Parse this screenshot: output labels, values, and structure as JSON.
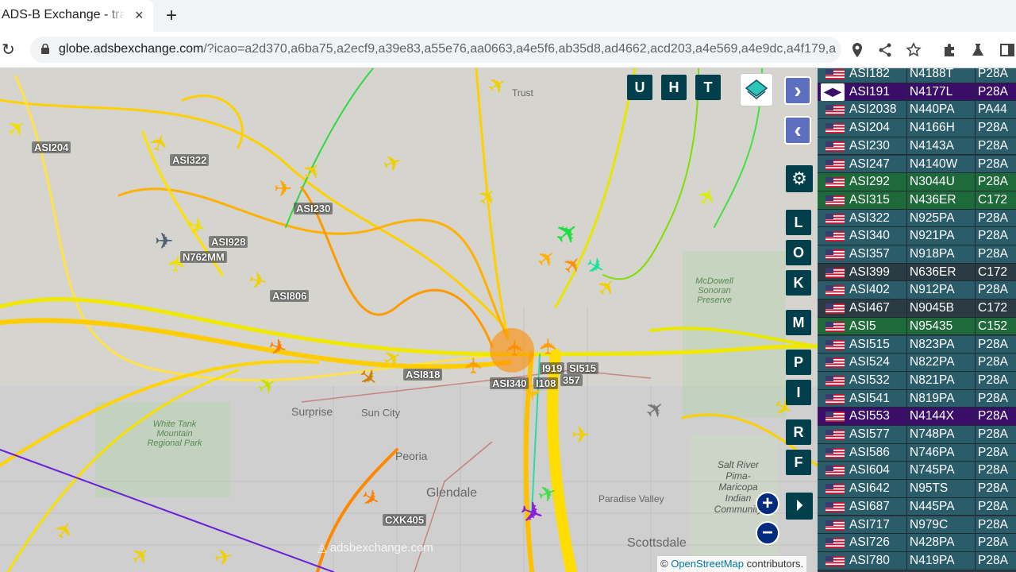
{
  "browser": {
    "tab_title": "ADS-B Exchange - track aircraft live",
    "tab_close": "×",
    "new_tab": "+",
    "url_host": "globe.adsbexchange.com",
    "url_rest": "/?icao=a2d370,a6ba75,a2ecf9,a39e83,a55e76,aa0663,a4e5f6,ab35d8,ad4662,acd203,a4e569,a4e9dc,a4f179,a..."
  },
  "map": {
    "buttons_top": [
      "U",
      "H",
      "T"
    ],
    "buttons_side": [
      "L",
      "O",
      "K",
      "M",
      "P",
      "I",
      "R",
      "F"
    ],
    "nav_forward": "›",
    "nav_back": "‹",
    "zoom_in": "+",
    "zoom_out": "−",
    "watermark": "adsbexchange.com",
    "attribution_prefix": "©",
    "attribution_link": "OpenStreetMap",
    "attribution_suffix": "contributors.",
    "labels": [
      {
        "text": "ASI204"
      },
      {
        "text": "ASI322"
      },
      {
        "text": "ASI230"
      },
      {
        "text": "ASI928"
      },
      {
        "text": "N762MM"
      },
      {
        "text": "ASI806"
      },
      {
        "text": "ASI818"
      },
      {
        "text": "ASI340"
      },
      {
        "text": "I108"
      },
      {
        "text": "I919"
      },
      {
        "text": "SI515"
      },
      {
        "text": "357"
      },
      {
        "text": "CXK405"
      }
    ],
    "towns": [
      {
        "text": "Surprise"
      },
      {
        "text": "Sun City"
      },
      {
        "text": "Peoria"
      },
      {
        "text": "Glendale"
      },
      {
        "text": "Scottsdale"
      },
      {
        "text": "White Tank Mountain Regional Park"
      },
      {
        "text": "McDowell Sonoran Preserve"
      },
      {
        "text": "Salt River Pima-Maricopa Indian Community"
      },
      {
        "text": "Paradise Valley"
      },
      {
        "text": "Trust"
      }
    ]
  },
  "panel": {
    "rows": [
      {
        "callsign": "ASI182",
        "reg": "N4188T",
        "type": "P28A",
        "color": "#2a5c6a"
      },
      {
        "callsign": "ASI191",
        "reg": "N4177L",
        "type": "P28A",
        "color": "#3a0e68"
      },
      {
        "callsign": "ASI2038",
        "reg": "N440PA",
        "type": "PA44",
        "color": "#2a5c6a"
      },
      {
        "callsign": "ASI204",
        "reg": "N4166H",
        "type": "P28A",
        "color": "#2a5c6a"
      },
      {
        "callsign": "ASI230",
        "reg": "N4143A",
        "type": "P28A",
        "color": "#2a5c6a"
      },
      {
        "callsign": "ASI247",
        "reg": "N4140W",
        "type": "P28A",
        "color": "#2a5c6a"
      },
      {
        "callsign": "ASI292",
        "reg": "N3044U",
        "type": "P28A",
        "color": "#1f6a3a"
      },
      {
        "callsign": "ASI315",
        "reg": "N436ER",
        "type": "C172",
        "color": "#1f6a3a"
      },
      {
        "callsign": "ASI322",
        "reg": "N925PA",
        "type": "P28A",
        "color": "#2a5c6a"
      },
      {
        "callsign": "ASI340",
        "reg": "N921PA",
        "type": "P28A",
        "color": "#2a5c6a"
      },
      {
        "callsign": "ASI357",
        "reg": "N918PA",
        "type": "P28A",
        "color": "#2a5c6a"
      },
      {
        "callsign": "ASI399",
        "reg": "N636ER",
        "type": "C172",
        "color": "#2a3b44"
      },
      {
        "callsign": "ASI402",
        "reg": "N912PA",
        "type": "P28A",
        "color": "#2a5c6a"
      },
      {
        "callsign": "ASI467",
        "reg": "N9045B",
        "type": "C172",
        "color": "#2a3b44"
      },
      {
        "callsign": "ASI5",
        "reg": "N95435",
        "type": "C152",
        "color": "#1f6a3a"
      },
      {
        "callsign": "ASI515",
        "reg": "N823PA",
        "type": "P28A",
        "color": "#2a5c6a"
      },
      {
        "callsign": "ASI524",
        "reg": "N822PA",
        "type": "P28A",
        "color": "#2a5c6a"
      },
      {
        "callsign": "ASI532",
        "reg": "N821PA",
        "type": "P28A",
        "color": "#2a5c6a"
      },
      {
        "callsign": "ASI541",
        "reg": "N819PA",
        "type": "P28A",
        "color": "#2a5c6a"
      },
      {
        "callsign": "ASI553",
        "reg": "N4144X",
        "type": "P28A",
        "color": "#3a0e68"
      },
      {
        "callsign": "ASI577",
        "reg": "N748PA",
        "type": "P28A",
        "color": "#2a5c6a"
      },
      {
        "callsign": "ASI586",
        "reg": "N746PA",
        "type": "P28A",
        "color": "#2a5c6a"
      },
      {
        "callsign": "ASI604",
        "reg": "N745PA",
        "type": "P28A",
        "color": "#2a5c6a"
      },
      {
        "callsign": "ASI642",
        "reg": "N95TS",
        "type": "P28A",
        "color": "#2a5c6a"
      },
      {
        "callsign": "ASI687",
        "reg": "N445PA",
        "type": "P28A",
        "color": "#2a5c6a"
      },
      {
        "callsign": "ASI717",
        "reg": "N979C",
        "type": "P28A",
        "color": "#2a5c6a"
      },
      {
        "callsign": "ASI726",
        "reg": "N428PA",
        "type": "P28A",
        "color": "#2a5c6a"
      },
      {
        "callsign": "ASI780",
        "reg": "N419PA",
        "type": "P28A",
        "color": "#2a5c6a"
      }
    ]
  }
}
